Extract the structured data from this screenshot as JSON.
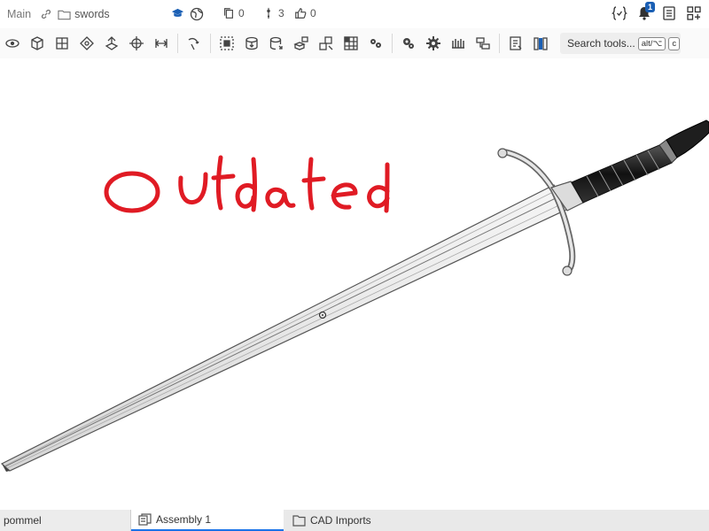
{
  "header": {
    "branch": "Main",
    "document_name": "swords",
    "copies_count": "0",
    "branches_count": "3",
    "likes_count": "0",
    "notifications_badge": "1"
  },
  "toolbar": {
    "icons": [
      "mate-fastened-icon",
      "mate-revolute-icon",
      "mate-slider-icon",
      "mate-planar-icon",
      "mate-cylindrical-icon",
      "mate-pin-slot-icon",
      "mate-ball-icon",
      "relation-icon",
      "group-icon",
      "insert-icon",
      "insert-from-icon",
      "replicate-icon",
      "explode-icon",
      "pattern-icon",
      "configure-icon",
      "settings-icon",
      "gear-icon",
      "rack-icon",
      "mate-connector-icon",
      "bom-icon",
      "bookshelf-icon"
    ],
    "search_label": "Search tools...",
    "search_shortcut_1": "alt/⌥",
    "search_shortcut_2": "c"
  },
  "canvas": {
    "annotation_text": "Outdated",
    "annotation_color": "#e01b24"
  },
  "tabs": [
    {
      "label": "pommel"
    },
    {
      "label": "Assembly 1"
    },
    {
      "label": "CAD Imports"
    }
  ],
  "colors": {
    "accent": "#1a73e8",
    "badge": "#1a5fb4"
  }
}
